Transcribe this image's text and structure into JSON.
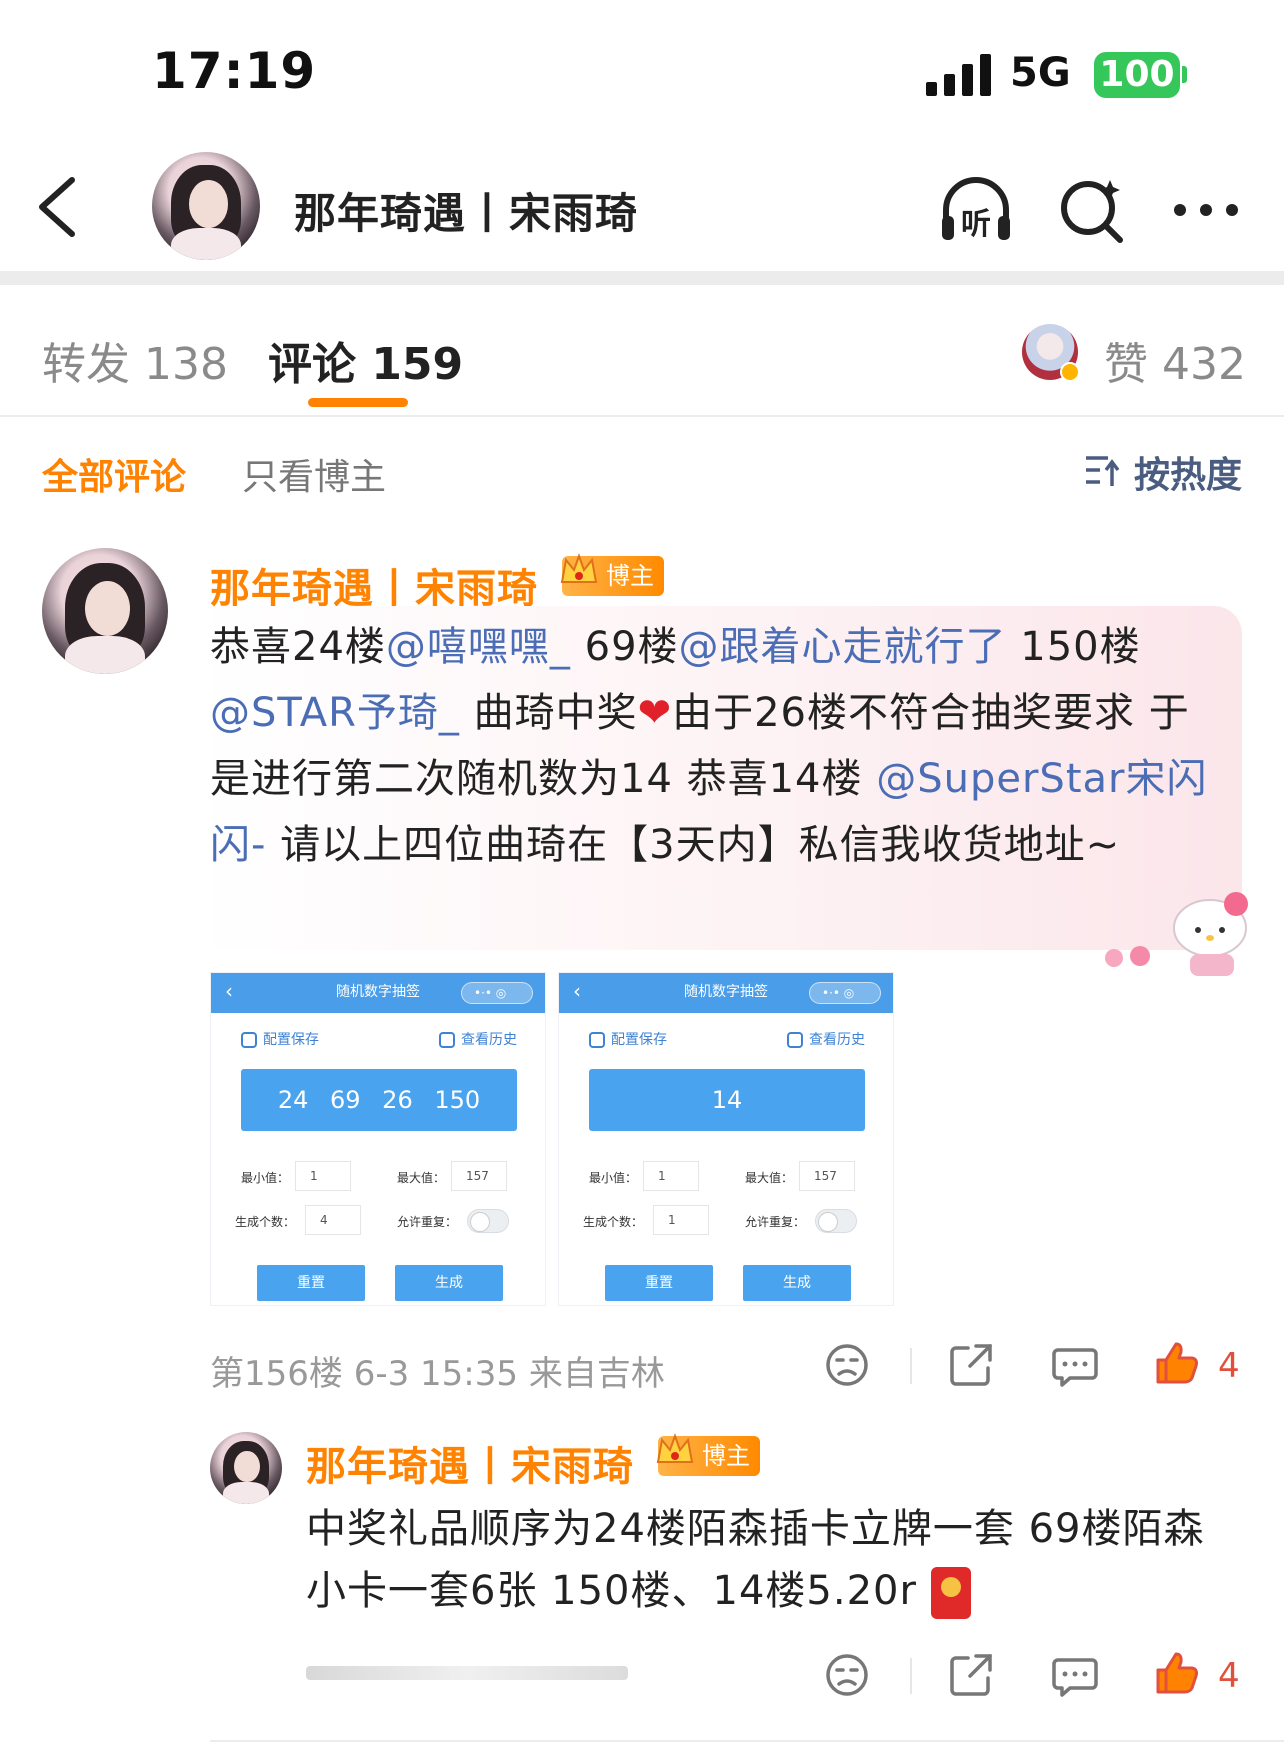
{
  "status_bar": {
    "time": "17:19",
    "network": "5G",
    "battery": "100"
  },
  "header": {
    "title": "那年琦遇丨宋雨琦",
    "listen_label": "听"
  },
  "tabs": [
    {
      "label": "转发 138"
    },
    {
      "label": "评论 159"
    }
  ],
  "likes": {
    "label": "赞 432"
  },
  "filters": {
    "all": "全部评论",
    "author_only": "只看博主",
    "sort": "按热度"
  },
  "colors": {
    "accent": "#ff8200",
    "mention": "#4a6db5",
    "like": "#e0503c"
  },
  "comment": {
    "username": "那年琦遇丨宋雨琦",
    "badge": "博主",
    "segments": [
      {
        "text": "恭喜24楼",
        "type": "text"
      },
      {
        "text": "@嘻嘿嘿_",
        "type": "mention"
      },
      {
        "text": " 69楼",
        "type": "text"
      },
      {
        "text": "@跟着心走就行了",
        "type": "mention"
      },
      {
        "text": " 150楼",
        "type": "text"
      },
      {
        "text": "@STAR予琦_",
        "type": "mention"
      },
      {
        "text": " 曲琦中奖",
        "type": "text"
      },
      {
        "text": "❤",
        "type": "emoji"
      },
      {
        "text": "由于26楼不符合抽奖要求 于是进行第二次随机数为14 恭喜14楼 ",
        "type": "text"
      },
      {
        "text": "@SuperStar宋闪闪-",
        "type": "mention"
      },
      {
        "text": " 请以上四位曲琦在【3天内】私信我收货地址~",
        "type": "text"
      }
    ],
    "images": [
      {
        "title": "随机数字抽签",
        "config_label": "配置保存",
        "history_label": "查看历史",
        "result": "24  69  26  150",
        "min_label": "最小值：",
        "min_value": "1",
        "max_label": "最大值：",
        "max_value": "157",
        "count_label": "生成个数：",
        "count_value": "4",
        "repeat_label": "允许重复：",
        "reset_label": "重置",
        "generate_label": "生成"
      },
      {
        "title": "随机数字抽签",
        "config_label": "配置保存",
        "history_label": "查看历史",
        "result": "14",
        "min_label": "最小值：",
        "min_value": "1",
        "max_label": "最大值：",
        "max_value": "157",
        "count_label": "生成个数：",
        "count_value": "1",
        "repeat_label": "允许重复：",
        "reset_label": "重置",
        "generate_label": "生成"
      }
    ],
    "meta": "第156楼 6-3 15:35 来自吉林",
    "like_count": "4"
  },
  "reply": {
    "username": "那年琦遇丨宋雨琦",
    "badge": "博主",
    "text": "中奖礼品顺序为24楼陌森插卡立牌一套 69楼陌森小卡一套6张 150楼、14楼5.20r",
    "like_count": "4"
  }
}
